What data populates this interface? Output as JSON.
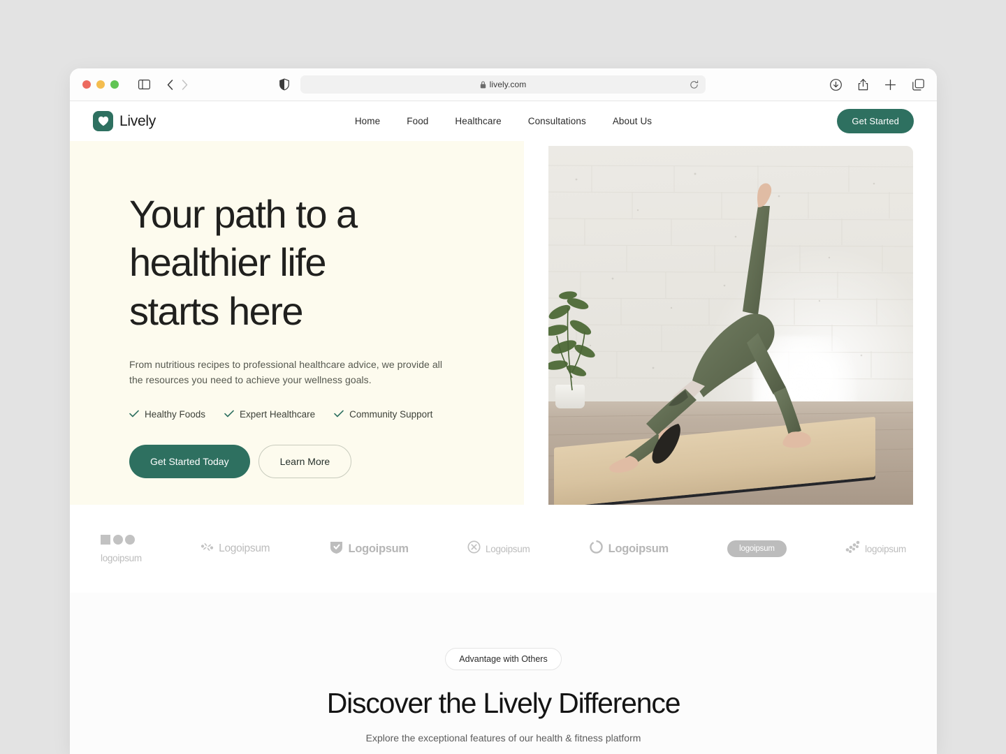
{
  "browser": {
    "url": "lively.com",
    "lock_icon": "lock-icon",
    "reload_icon": "reload-icon",
    "shield_icon": "privacy-shield-icon",
    "sidebar_icon": "sidebar-toggle-icon",
    "back_icon": "back-arrow-icon",
    "forward_icon": "forward-arrow-icon",
    "right_icons": [
      "downloads-icon",
      "share-icon",
      "new-tab-icon",
      "tab-overview-icon"
    ],
    "traffic_lights": [
      "close-button",
      "minimize-button",
      "maximize-button"
    ]
  },
  "site": {
    "brand": {
      "name": "Lively",
      "mark_icon": "heart-icon",
      "mark_color": "#2e7060"
    },
    "nav": [
      {
        "label": "Home"
      },
      {
        "label": "Food"
      },
      {
        "label": "Healthcare"
      },
      {
        "label": "Consultations"
      },
      {
        "label": "About Us"
      }
    ],
    "header_cta": "Get Started"
  },
  "hero": {
    "title": "Your path to a healthier life starts here",
    "subtitle": "From nutritious recipes to professional healthcare advice, we provide all the resources you need to achieve your wellness goals.",
    "features": [
      {
        "label": "Healthy Foods",
        "icon": "check-icon"
      },
      {
        "label": "Expert Healthcare",
        "icon": "check-icon"
      },
      {
        "label": "Community Support",
        "icon": "check-icon"
      }
    ],
    "primary_cta": "Get Started Today",
    "secondary_cta": "Learn More",
    "background_color": "#fdfbee",
    "image_alt": "woman doing three-legged downward dog yoga pose on a tan mat in a bright room with white brick wall"
  },
  "logos": [
    {
      "text": "logoipsum",
      "style": "stacked",
      "mark": "squares-circles-icon"
    },
    {
      "text": "Logoipsum",
      "style": "inline",
      "mark": "pinwheel-icon"
    },
    {
      "text": "Logoipsum",
      "style": "inline-bold",
      "mark": "shield-icon"
    },
    {
      "text": "Logoipsum",
      "style": "inline-small",
      "mark": "circle-x-icon"
    },
    {
      "text": "Logoipsum",
      "style": "inline-bold",
      "mark": "blob-icon"
    },
    {
      "text": "logoipsum",
      "style": "pill",
      "mark": "none"
    },
    {
      "text": "logoipsum",
      "style": "inline-small",
      "mark": "dots-icon"
    }
  ],
  "advantage": {
    "badge": "Advantage with Others",
    "title": "Discover the Lively Difference",
    "subtitle": "Explore the exceptional features of our health & fitness platform"
  },
  "colors": {
    "desktop": "#e3e3e3",
    "accent": "#2e7060",
    "hero_bg": "#fdfbee"
  }
}
